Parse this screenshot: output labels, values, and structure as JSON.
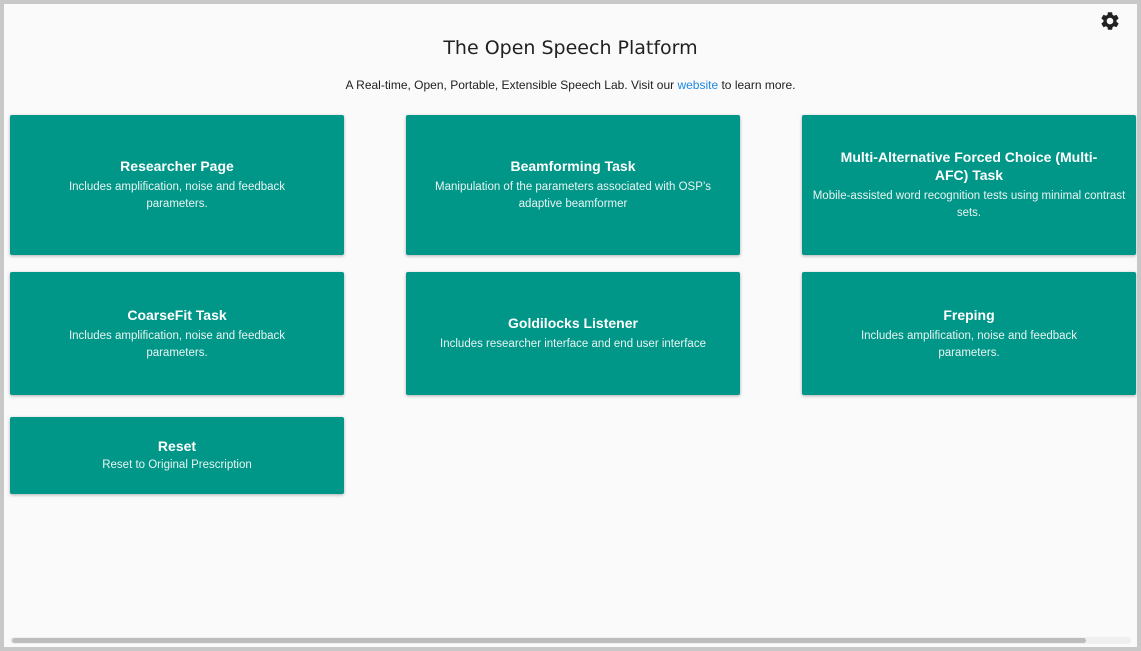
{
  "header": {
    "title": "The Open Speech Platform",
    "subtitle_prefix": "A Real-time, Open, Portable, Extensible Speech Lab. Visit our ",
    "subtitle_link": "website",
    "subtitle_suffix": " to learn more."
  },
  "icons": {
    "settings": "gear-icon"
  },
  "colors": {
    "card_background": "#009688",
    "link": "#1e88e5"
  },
  "cards": [
    {
      "title": "Researcher Page",
      "description": "Includes amplification, noise and feedback parameters."
    },
    {
      "title": "Beamforming Task",
      "description": "Manipulation of the parameters associated with OSP’s adaptive beamformer"
    },
    {
      "title": "Multi-Alternative Forced Choice (Multi-AFC) Task",
      "description": "Mobile-assisted word recognition tests using minimal contrast sets."
    },
    {
      "title": "CoarseFit Task",
      "description": "Includes amplification, noise and feedback parameters."
    },
    {
      "title": "Goldilocks Listener",
      "description": "Includes researcher interface and end user interface"
    },
    {
      "title": "Freping",
      "description": "Includes amplification, noise and feedback parameters."
    },
    {
      "title": "Reset",
      "description": "Reset to Original Prescription"
    }
  ]
}
